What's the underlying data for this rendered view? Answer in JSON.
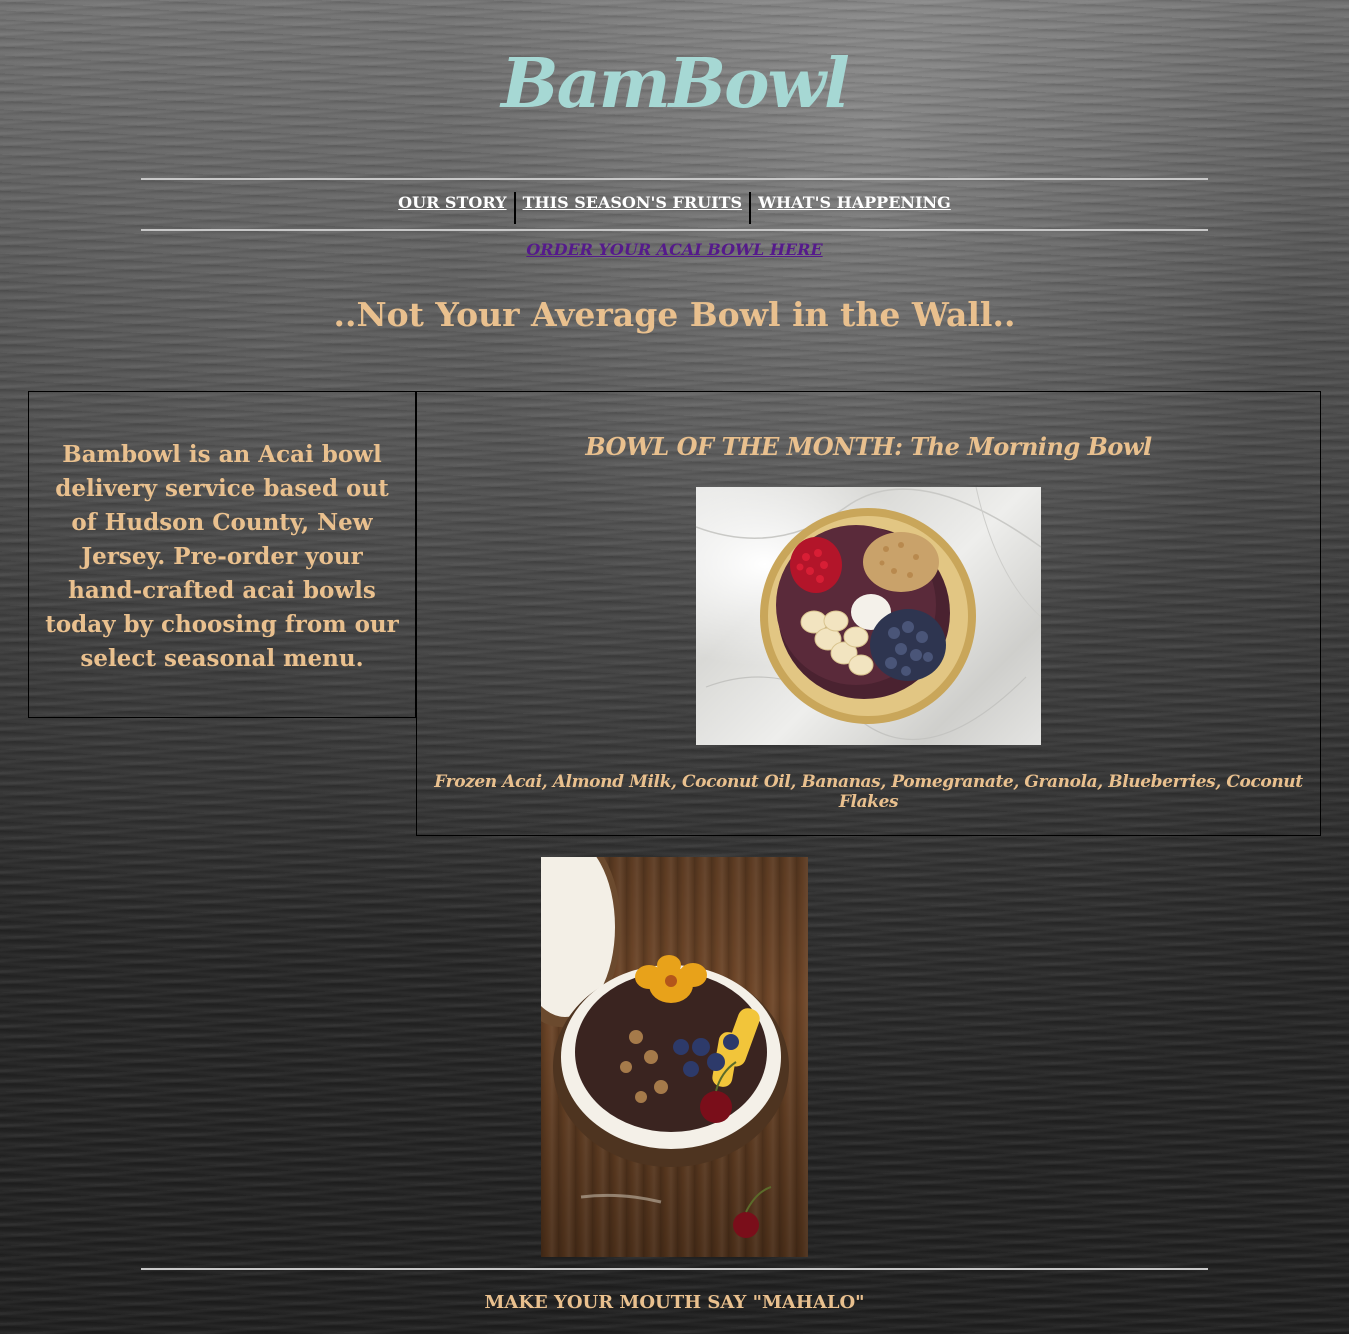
{
  "brand": {
    "logo": "BamBowl"
  },
  "nav": {
    "items": [
      {
        "label": "OUR STORY"
      },
      {
        "label": "THIS SEASON'S FRUITS"
      },
      {
        "label": "WHAT'S HAPPENING"
      }
    ],
    "order_link": "ORDER YOUR ACAI BOWL HERE"
  },
  "hero": {
    "tagline": "..Not Your Average Bowl in the Wall.."
  },
  "about": {
    "text": "Bambowl is an Acai bowl delivery service based out of Hudson County, New Jersey. Pre-order your hand-crafted acai bowls today by choosing from our select seasonal menu."
  },
  "bowl_of_the_month": {
    "title": "BOWL OF THE MONTH: The Morning Bowl",
    "ingredients": "Frozen Acai, Almond Milk, Coconut Oil, Bananas, Pomegranate, Granola, Blueberries, Coconut Flakes"
  },
  "footer": {
    "slogan": "MAKE YOUR MOUTH SAY \"MAHALO\""
  },
  "colors": {
    "logo": "#a6d8d4",
    "accent_text": "#e9c08e",
    "nav_text": "#ffffff",
    "visited_link": "#551a8b"
  }
}
